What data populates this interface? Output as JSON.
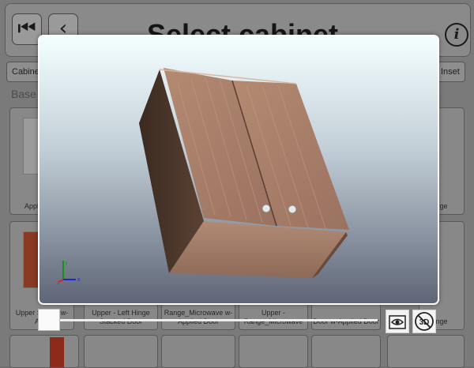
{
  "header": {
    "title": "Select cabinet",
    "first_icon": "skip-back-icon",
    "back_icon": "chevron-left-icon",
    "info_label": "i"
  },
  "tabs": [
    {
      "label": "Cabine"
    },
    {
      "label": "Inset"
    }
  ],
  "section_label": "Base",
  "cells": [
    {
      "label": "Appli Uppe"
    },
    {
      "label": "nge"
    },
    {
      "label": "Upper Stacke w- Appl"
    },
    {
      "label": "Upper - Left Hinge Stacked Door"
    },
    {
      "label": "Range_Microwave w-Applied Door"
    },
    {
      "label": "Upper - Range_Microwave"
    },
    {
      "label": "Door w-Applied Door"
    },
    {
      "label": "nge"
    }
  ],
  "viewer": {
    "axes": {
      "x": "x",
      "y": "y",
      "z": "z"
    },
    "slider": {
      "value": 0
    },
    "eye_button_icon": "eye-view-icon",
    "toggle_3d_icon": "3d-off-icon",
    "toggle_3d_label": "3D"
  },
  "colors": {
    "wood_front": "#a97f68",
    "wood_side": "#4a3428",
    "overlay": "#6f6f6f"
  }
}
